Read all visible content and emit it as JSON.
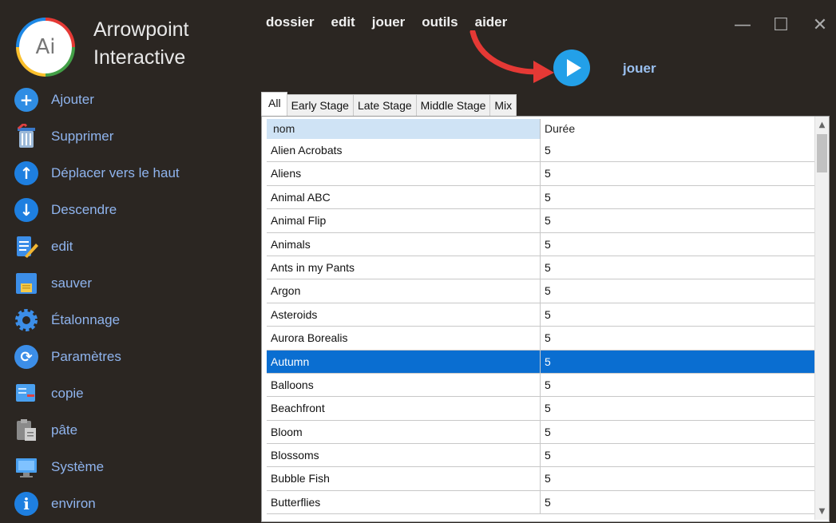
{
  "brand": {
    "logo_text": "Ai",
    "line1": "Arrowpoint",
    "line2": "Interactive"
  },
  "menu": [
    "dossier",
    "edit",
    "jouer",
    "outils",
    "aider"
  ],
  "window_controls": {
    "minimize": "—",
    "maximize": "☐",
    "close": "✕"
  },
  "sidebar": [
    {
      "label": "Ajouter",
      "icon": "add-icon"
    },
    {
      "label": "Supprimer",
      "icon": "trash-icon"
    },
    {
      "label": "Déplacer vers le haut",
      "icon": "arrow-up-icon"
    },
    {
      "label": "Descendre",
      "icon": "arrow-down-icon"
    },
    {
      "label": "edit",
      "icon": "edit-icon"
    },
    {
      "label": "sauver",
      "icon": "save-icon"
    },
    {
      "label": "Étalonnage",
      "icon": "gear-icon"
    },
    {
      "label": "Paramètres",
      "icon": "refresh-icon"
    },
    {
      "label": "copie",
      "icon": "copy-icon"
    },
    {
      "label": "pâte",
      "icon": "paste-icon"
    },
    {
      "label": "Système",
      "icon": "system-icon"
    },
    {
      "label": "environ",
      "icon": "info-icon"
    }
  ],
  "play": {
    "label": "jouer"
  },
  "tabs": [
    "All",
    "Early Stage",
    "Late Stage",
    "Middle Stage",
    "Mix"
  ],
  "active_tab": "All",
  "table": {
    "columns": [
      "nom",
      "Durée"
    ],
    "selected_row": "Autumn",
    "rows": [
      [
        "Alien Acrobats",
        "5"
      ],
      [
        "Aliens",
        "5"
      ],
      [
        "Animal ABC",
        "5"
      ],
      [
        "Animal Flip",
        "5"
      ],
      [
        "Animals",
        "5"
      ],
      [
        "Ants in my Pants",
        "5"
      ],
      [
        "Argon",
        "5"
      ],
      [
        "Asteroids",
        "5"
      ],
      [
        "Aurora Borealis",
        "5"
      ],
      [
        "Autumn",
        "5"
      ],
      [
        "Balloons",
        "5"
      ],
      [
        "Beachfront",
        "5"
      ],
      [
        "Bloom",
        "5"
      ],
      [
        "Blossoms",
        "5"
      ],
      [
        "Bubble Fish",
        "5"
      ],
      [
        "Butterflies",
        "5"
      ]
    ]
  },
  "colors": {
    "background": "#2b2622",
    "accent": "#0a6ed1",
    "sidebar_text": "#8fb4ee",
    "play": "#23a0e8",
    "arrow": "#e53935"
  }
}
